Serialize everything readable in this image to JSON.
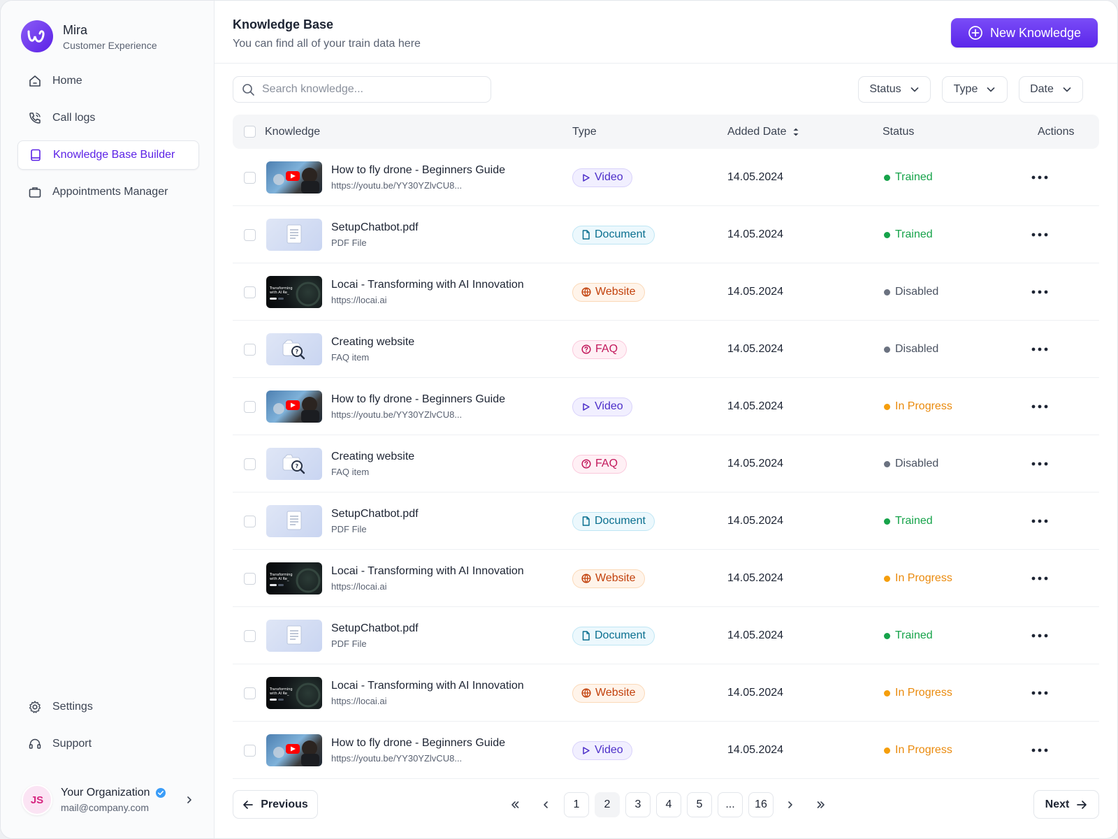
{
  "brand": {
    "name": "Mira",
    "subtitle": "Customer Experience",
    "logo_icon": "w-logo-icon",
    "accent": "#5b21e6"
  },
  "sidebar": {
    "items": [
      {
        "label": "Home",
        "icon": "home-icon",
        "active": false
      },
      {
        "label": "Call logs",
        "icon": "phone-icon",
        "active": false
      },
      {
        "label": "Knowledge Base Builder",
        "icon": "book-icon",
        "active": true
      },
      {
        "label": "Appointments Manager",
        "icon": "briefcase-icon",
        "active": false
      }
    ],
    "bottom_items": [
      {
        "label": "Settings",
        "icon": "gear-icon"
      },
      {
        "label": "Support",
        "icon": "headset-icon"
      }
    ],
    "profile": {
      "initials": "JS",
      "name": "Your Organization",
      "email": "mail@company.com"
    }
  },
  "header": {
    "title": "Knowledge Base",
    "subtitle": "You can find all of your train data here",
    "new_button_label": "New Knowledge"
  },
  "toolbar": {
    "search_placeholder": "Search knowledge...",
    "filters": [
      "Status",
      "Type",
      "Date"
    ]
  },
  "table": {
    "columns": {
      "knowledge": "Knowledge",
      "type": "Type",
      "added_date": "Added Date",
      "status": "Status",
      "actions": "Actions"
    },
    "rows": [
      {
        "title": "How to fly drone - Beginners Guide",
        "sub": "https://youtu.be/YY30YZlvCU8...",
        "type": "Video",
        "kind": "video",
        "date": "14.05.2024",
        "status": "Trained",
        "status_kind": "trained"
      },
      {
        "title": "SetupChatbot.pdf",
        "sub": "PDF File",
        "type": "Document",
        "kind": "doc",
        "date": "14.05.2024",
        "status": "Trained",
        "status_kind": "trained"
      },
      {
        "title": "Locai - Transforming with AI Innovation",
        "sub": "https://locai.ai",
        "type": "Website",
        "kind": "web",
        "date": "14.05.2024",
        "status": "Disabled",
        "status_kind": "disabled"
      },
      {
        "title": "Creating website",
        "sub": "FAQ item",
        "type": "FAQ",
        "kind": "faq",
        "date": "14.05.2024",
        "status": "Disabled",
        "status_kind": "disabled"
      },
      {
        "title": "How to fly drone - Beginners Guide",
        "sub": "https://youtu.be/YY30YZlvCU8...",
        "type": "Video",
        "kind": "video",
        "date": "14.05.2024",
        "status": "In Progress",
        "status_kind": "progress"
      },
      {
        "title": "Creating website",
        "sub": "FAQ item",
        "type": "FAQ",
        "kind": "faq",
        "date": "14.05.2024",
        "status": "Disabled",
        "status_kind": "disabled"
      },
      {
        "title": "SetupChatbot.pdf",
        "sub": "PDF File",
        "type": "Document",
        "kind": "doc",
        "date": "14.05.2024",
        "status": "Trained",
        "status_kind": "trained"
      },
      {
        "title": "Locai - Transforming with AI Innovation",
        "sub": "https://locai.ai",
        "type": "Website",
        "kind": "web",
        "date": "14.05.2024",
        "status": "In Progress",
        "status_kind": "progress"
      },
      {
        "title": "SetupChatbot.pdf",
        "sub": "PDF File",
        "type": "Document",
        "kind": "doc",
        "date": "14.05.2024",
        "status": "Trained",
        "status_kind": "trained"
      },
      {
        "title": "Locai - Transforming with AI Innovation",
        "sub": "https://locai.ai",
        "type": "Website",
        "kind": "web",
        "date": "14.05.2024",
        "status": "In Progress",
        "status_kind": "progress"
      },
      {
        "title": "How to fly drone - Beginners Guide",
        "sub": "https://youtu.be/YY30YZlvCU8...",
        "type": "Video",
        "kind": "video",
        "date": "14.05.2024",
        "status": "In Progress",
        "status_kind": "progress"
      }
    ]
  },
  "pagination": {
    "previous_label": "Previous",
    "next_label": "Next",
    "pages": [
      "1",
      "2",
      "3",
      "4",
      "5",
      "...",
      "16"
    ],
    "current_page": "2"
  },
  "colors": {
    "trained": "#16a34a",
    "disabled": "#6b7280",
    "in_progress": "#f59e0b"
  }
}
